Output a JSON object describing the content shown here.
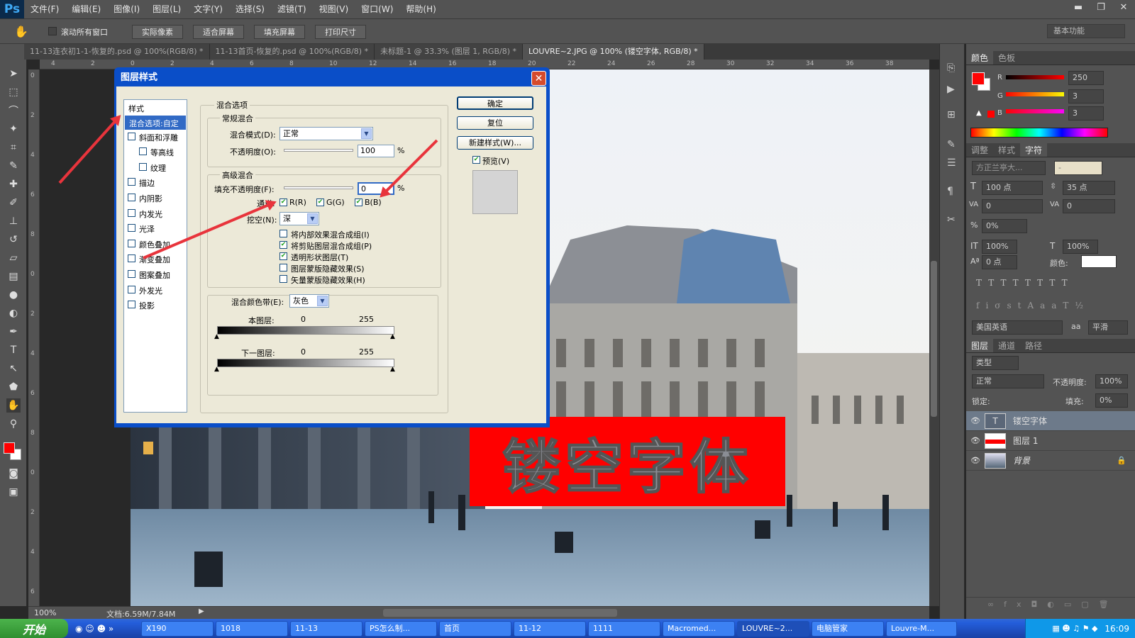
{
  "app": {
    "logo": "Ps",
    "menus": [
      "文件(F)",
      "编辑(E)",
      "图像(I)",
      "图层(L)",
      "文字(Y)",
      "选择(S)",
      "滤镜(T)",
      "视图(V)",
      "窗口(W)",
      "帮助(H)"
    ]
  },
  "options": {
    "scroll_all": "滚动所有窗口",
    "buttons": [
      "实际像素",
      "适合屏幕",
      "填充屏幕",
      "打印尺寸"
    ],
    "workspace": "基本功能"
  },
  "tabs": [
    "11-13连衣初1-1-恢复的.psd @ 100%(RGB/8) *",
    "11-13首页-恢复的.psd @ 100%(RGB/8) *",
    "未标题-1 @ 33.3% (图层 1, RGB/8) *",
    "LOUVRE~2.JPG @ 100% (镂空字体, RGB/8) *"
  ],
  "ruler_h": [
    "4",
    "2",
    "0",
    "2",
    "4",
    "6",
    "8",
    "10",
    "12",
    "14",
    "16",
    "18",
    "20",
    "22",
    "24",
    "26",
    "28",
    "30",
    "32",
    "34",
    "36",
    "38"
  ],
  "ruler_v": [
    "0",
    "2",
    "4",
    "6",
    "8",
    "0",
    "2",
    "4",
    "6",
    "8",
    "0",
    "2",
    "4",
    "6"
  ],
  "canvas": {
    "hollow_text": "镂空字体",
    "accent": "#ff0000"
  },
  "status": {
    "zoom": "100%",
    "doc": "文档:6.59M/7.84M"
  },
  "dialog": {
    "title": "图层样式",
    "style_header": "样式",
    "styles": [
      "混合选项:自定",
      "斜面和浮雕",
      "等高线",
      "纹理",
      "描边",
      "内阴影",
      "内发光",
      "光泽",
      "颜色叠加",
      "渐变叠加",
      "图案叠加",
      "外发光",
      "投影"
    ],
    "section_blend": "混合选项",
    "group_normal": "常规混合",
    "blend_mode_label": "混合模式(D):",
    "blend_mode_value": "正常",
    "opacity_label": "不透明度(O):",
    "opacity_value": "100",
    "pct": "%",
    "group_advanced": "高级混合",
    "fill_label": "填充不透明度(F):",
    "fill_value": "0",
    "channels_label": "通道:",
    "ch_r": "R(R)",
    "ch_g": "G(G)",
    "ch_b": "B(B)",
    "knockout_label": "挖空(N):",
    "knockout_value": "深",
    "adv_opts": [
      "将内部效果混合成组(I)",
      "将剪贴图层混合成组(P)",
      "透明形状图层(T)",
      "图层蒙版隐藏效果(S)",
      "矢量蒙版隐藏效果(H)"
    ],
    "blend_if_label": "混合颜色带(E):",
    "blend_if_value": "灰色",
    "this_layer": "本图层:",
    "underlying": "下一图层:",
    "lo": "0",
    "hi": "255",
    "ok": "确定",
    "reset": "复位",
    "new_style": "新建样式(W)...",
    "preview": "预览(V)"
  },
  "color_panel": {
    "tabs": [
      "颜色",
      "色板"
    ],
    "r_label": "R",
    "g_label": "G",
    "b_label": "B",
    "r": "250",
    "g": "3",
    "b": "3"
  },
  "char_panel": {
    "tabs": [
      "调整",
      "样式",
      "字符"
    ],
    "font": "方正兰亭大...",
    "style": "-",
    "size": "100 点",
    "leading": "35 点",
    "kern": "0",
    "track": "0",
    "scale_pct": "0%",
    "vscale": "100%",
    "hscale": "100%",
    "baseline": "0 点",
    "color_label": "颜色:",
    "lang": "美国英语",
    "aa_label": "aa",
    "aa": "平滑"
  },
  "layers_panel": {
    "tabs": [
      "图层",
      "通道",
      "路径"
    ],
    "kind": "类型",
    "mode": "正常",
    "opacity_label": "不透明度:",
    "opacity": "100%",
    "lock_label": "锁定:",
    "fill_label": "填充:",
    "fill": "0%",
    "layers": [
      "镂空字体",
      "图层 1",
      "背景"
    ]
  },
  "taskbar": {
    "start": "开始",
    "tasks": [
      "X190",
      "1018",
      "11-13",
      "PS怎么制...",
      "首页",
      "11-12",
      "1111",
      "Macromed...",
      "LOUVRE~2...",
      "电脑管家",
      "Louvre-M..."
    ],
    "time": "16:09"
  }
}
